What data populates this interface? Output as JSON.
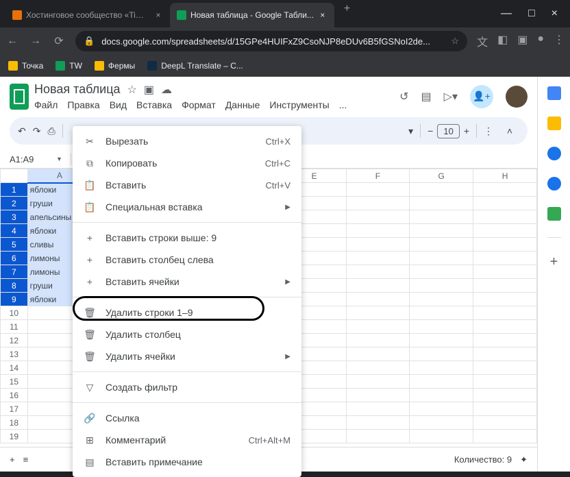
{
  "browser": {
    "tabs": [
      {
        "title": "Хостинговое сообщество «Time..."
      },
      {
        "title": "Новая таблица - Google Табли..."
      }
    ],
    "url": "docs.google.com/spreadsheets/d/15GPe4HUIFxZ9CsoNJP8eDUv6B5fGSNoI2de..."
  },
  "bookmarks": [
    {
      "label": "Точка",
      "color": "#fbbc04"
    },
    {
      "label": "TW",
      "color": "#0f9d58"
    },
    {
      "label": "Фермы",
      "color": "#fbbc04"
    },
    {
      "label": "DeepL Translate – С...",
      "color": "#0f2b46"
    }
  ],
  "doc": {
    "title": "Новая таблица",
    "menus": [
      "Файл",
      "Правка",
      "Вид",
      "Вставка",
      "Формат",
      "Данные",
      "Инструменты",
      "..."
    ],
    "namebox": "A1:A9",
    "font_size": "10"
  },
  "columns": [
    "A",
    "B",
    "C",
    "D",
    "E",
    "F",
    "G",
    "H"
  ],
  "cells": [
    "яблоки",
    "груши",
    "апельсины",
    "яблоки",
    "сливы",
    "лимоны",
    "лимоны",
    "груши",
    "яблоки"
  ],
  "row_count": 19,
  "footer": {
    "count_label": "Количество: 9"
  },
  "context_menu": {
    "cut": {
      "label": "Вырезать",
      "shortcut": "Ctrl+X"
    },
    "copy": {
      "label": "Копировать",
      "shortcut": "Ctrl+C"
    },
    "paste": {
      "label": "Вставить",
      "shortcut": "Ctrl+V"
    },
    "paste_special": {
      "label": "Специальная вставка"
    },
    "insert_rows": {
      "label": "Вставить строки выше: 9"
    },
    "insert_col": {
      "label": "Вставить столбец слева"
    },
    "insert_cells": {
      "label": "Вставить ячейки"
    },
    "delete_rows": {
      "label": "Удалить строки 1–9"
    },
    "delete_col": {
      "label": "Удалить столбец"
    },
    "delete_cells": {
      "label": "Удалить ячейки"
    },
    "filter": {
      "label": "Создать фильтр"
    },
    "link": {
      "label": "Ссылка"
    },
    "comment": {
      "label": "Комментарий",
      "shortcut": "Ctrl+Alt+M"
    },
    "note": {
      "label": "Вставить примечание"
    }
  }
}
